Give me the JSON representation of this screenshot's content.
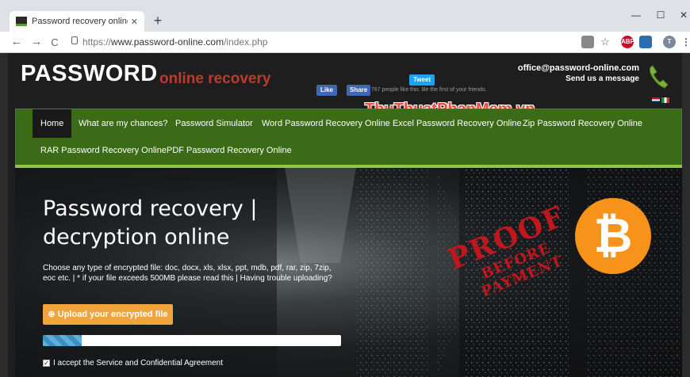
{
  "browser": {
    "tab_title": "Password recovery online excel, ",
    "tab_close": "✕",
    "new_tab": "+",
    "url_prefix": "https://",
    "url_host": "www.password-online.com",
    "url_path": "/index.php",
    "back": "←",
    "forward": "→",
    "reload": "C",
    "minimize": "—",
    "maximize": "☐",
    "close": "✕",
    "ext_adblock": "ABP",
    "profile_initial": "T"
  },
  "header": {
    "logo": "PASSWORD",
    "logo_sub": "online recovery",
    "tweet": "Tweet",
    "fb_like": "Like",
    "fb_share": "Share",
    "fb_text": "767 people like this. Be the first of your friends.",
    "email": "office@password-online.com",
    "send_message": "Send us a message",
    "watermark": "ThuThuatPhanMem.vn"
  },
  "nav": {
    "items": [
      "Home",
      "What are my chances?",
      "Password Simulator",
      "Word Password Recovery Online",
      "Excel Password Recovery Online",
      "Zip Password Recovery Online",
      "RAR Password Recovery Online",
      "PDF Password Recovery Online"
    ]
  },
  "hero": {
    "title_line1": "Password recovery |",
    "title_line2": "decryption online",
    "description": "Choose any type of encrypted file: doc, docx, xls, xlsx, ppt, mdb, pdf, rar, zip, 7zip, eoc etc.   |  * if your file exceeds 500MB please read this   |  Having trouble uploading?",
    "upload_button": "Upload your encrypted file",
    "progress": 0.13,
    "agreement": "I accept the Service and Confidential Agreement",
    "stamp_line1": "PROOF",
    "stamp_line2": "BEFORE",
    "stamp_line3": "PAYMENT",
    "bitcoin_symbol": "₿"
  }
}
